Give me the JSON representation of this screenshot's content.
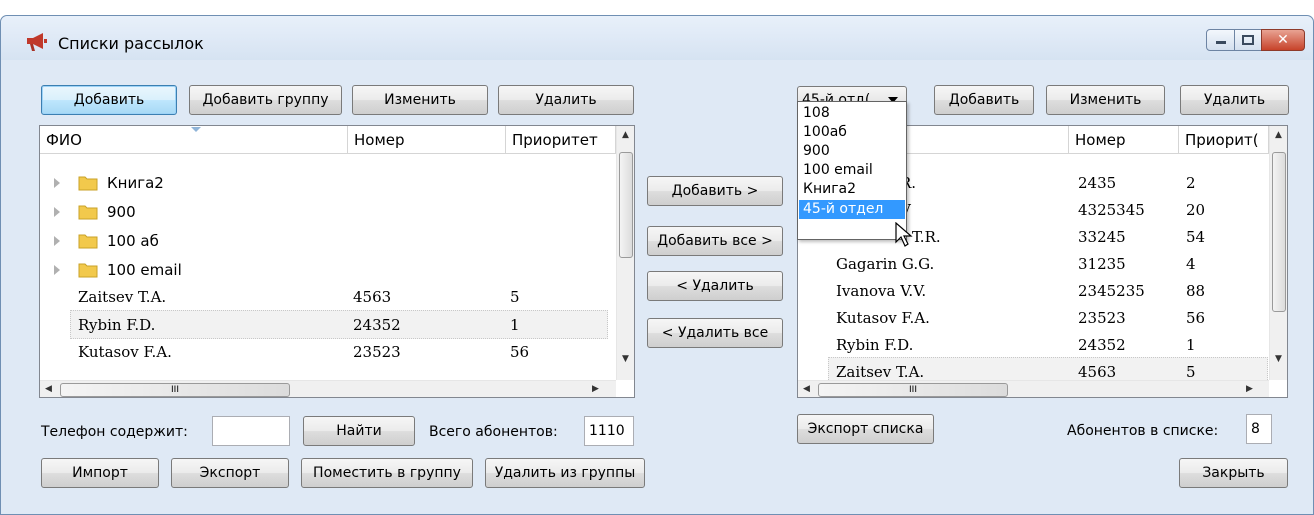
{
  "window": {
    "title": "Списки рассылок",
    "icon": "megaphone-icon",
    "minimize_icon": "minimize-icon",
    "maximize_icon": "maximize-icon",
    "close_glyph": "✕"
  },
  "left_toolbar": {
    "add": "Добавить",
    "add_group": "Добавить группу",
    "edit": "Изменить",
    "delete": "Удалить"
  },
  "left_table": {
    "columns": [
      "ФИО",
      "Номер",
      "Приоритет"
    ],
    "groups": [
      "Книга2",
      "900",
      "100 аб",
      "100 email"
    ],
    "rows": [
      {
        "name": "Zaitsev T.A.",
        "number": "4563",
        "priority": "5"
      },
      {
        "name": "Rybin F.D.",
        "number": "24352",
        "priority": "1"
      },
      {
        "name": "Kutasov F.A.",
        "number": "23523",
        "priority": "56"
      }
    ],
    "hscroll_glyph": "III"
  },
  "middle": {
    "add": "Добавить >",
    "add_all": "Добавить все >",
    "remove": "< Удалить",
    "remove_all": "< Удалить все"
  },
  "left_bottom": {
    "phone_label": "Телефон содержит:",
    "phone_value": "",
    "find": "Найти",
    "total_label": "Всего абонентов:",
    "total_value": "1110",
    "import": "Импорт",
    "export": "Экспорт",
    "put_in_group": "Поместить в группу",
    "remove_from_group": "Удалить из группы"
  },
  "right_toolbar": {
    "list_selected": "45-й отд(",
    "add": "Добавить",
    "edit": "Изменить",
    "delete": "Удалить"
  },
  "dropdown": {
    "options": [
      "108",
      "100аб",
      "900",
      "100 email",
      "Книга2",
      "45-й отдел"
    ],
    "highlighted_index": 5
  },
  "right_table": {
    "columns": [
      "Номер",
      "Приорит("
    ],
    "rows": [
      {
        "name": "R.",
        "number": "2435",
        "priority": "2"
      },
      {
        "name": "V",
        "number": "4325345",
        "priority": "20"
      },
      {
        "name": "T.R.",
        "number": "33245",
        "priority": "54"
      },
      {
        "name": "Gagarin G.G.",
        "number": "31235",
        "priority": "4"
      },
      {
        "name": "Ivanova V.V.",
        "number": "2345235",
        "priority": "88"
      },
      {
        "name": "Kutasov F.A.",
        "number": "23523",
        "priority": "56"
      },
      {
        "name": "Rybin F.D.",
        "number": "24352",
        "priority": "1"
      },
      {
        "name": "Zaitsev T.A.",
        "number": "4563",
        "priority": "5"
      }
    ],
    "hscroll_glyph": "III"
  },
  "right_bottom": {
    "export_list": "Экспорт списка",
    "count_label": "Абонентов в списке:",
    "count_value": "8",
    "close": "Закрыть"
  },
  "colors": {
    "accent": "#3399ff",
    "close_button": "#c7432a",
    "icon_red": "#c0392b"
  }
}
